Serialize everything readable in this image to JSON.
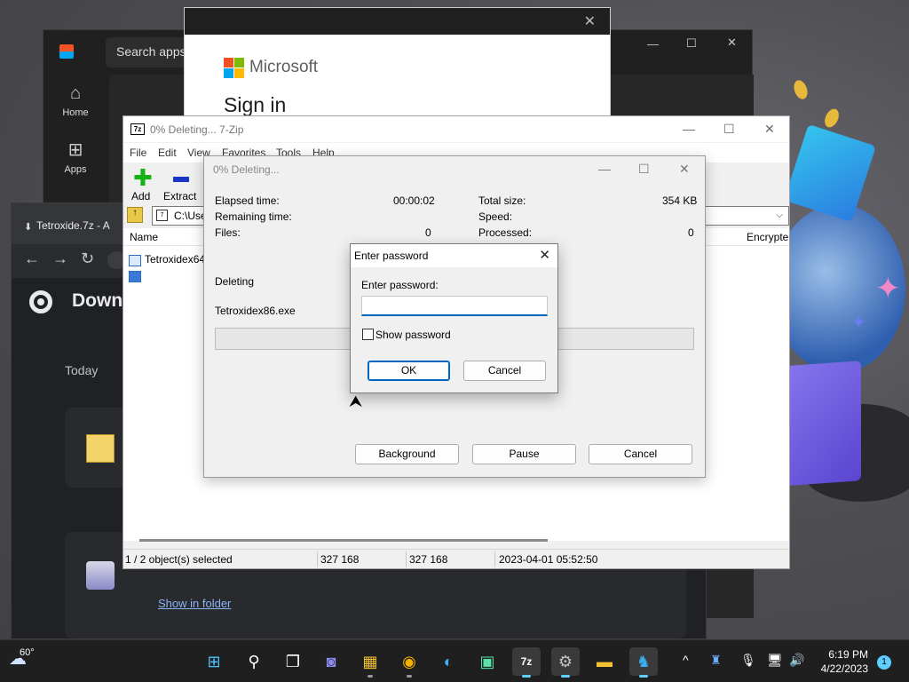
{
  "store": {
    "search_placeholder": "Search apps,",
    "nav": [
      {
        "label": "Home",
        "icon": "home-icon"
      },
      {
        "label": "Apps",
        "icon": "apps-icon"
      }
    ]
  },
  "signin": {
    "brand": "Microsoft",
    "title": "Sign in"
  },
  "chrome": {
    "tab_title": "Tetroxide.7z - A",
    "page_title": "Down",
    "section_today": "Today",
    "show_in_folder": "Show in folder"
  },
  "sevenzip": {
    "title": "0% Deleting... 7-Zip",
    "menu": [
      "File",
      "Edit",
      "View",
      "Favorites",
      "Tools",
      "Help"
    ],
    "toolbar": {
      "add": "Add",
      "extract": "Extract"
    },
    "address": "C:\\Use",
    "columns": {
      "name": "Name",
      "encrypted": "Encrypte"
    },
    "rows": [
      {
        "name": "Tetroxidex64.",
        "selected": false
      },
      {
        "name": "",
        "selected": true
      }
    ],
    "status": {
      "selection": "1 / 2 object(s) selected",
      "size": "327 168",
      "packed": "327 168",
      "modified": "2023-04-01 05:52:50"
    }
  },
  "progress": {
    "title": "0% Deleting...",
    "elapsed_label": "Elapsed time:",
    "elapsed_value": "00:00:02",
    "remaining_label": "Remaining time:",
    "files_label": "Files:",
    "files_value": "0",
    "total_size_label": "Total size:",
    "total_size_value": "354 KB",
    "speed_label": "Speed:",
    "processed_label": "Processed:",
    "processed_value": "0",
    "operation": "Deleting",
    "current_file": "Tetroxidex86.exe",
    "buttons": {
      "background": "Background",
      "pause": "Pause",
      "cancel": "Cancel"
    }
  },
  "password_dialog": {
    "title": "Enter password",
    "label": "Enter password:",
    "value": "",
    "show_password": "Show password",
    "ok": "OK",
    "cancel": "Cancel"
  },
  "taskbar": {
    "weather_temp": "60°",
    "time": "6:19 PM",
    "date": "4/22/2023",
    "notifications": "1"
  }
}
